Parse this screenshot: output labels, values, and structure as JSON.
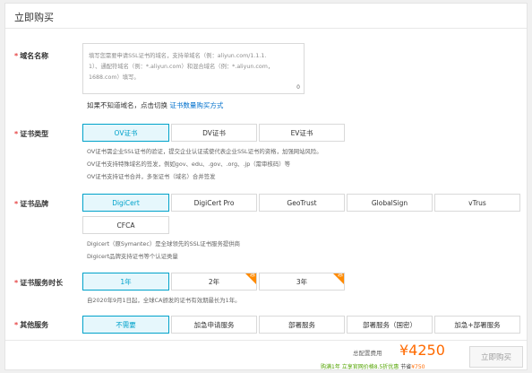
{
  "page_title": "立即购买",
  "domain": {
    "label": "域名名称",
    "required_mark": "*",
    "placeholder_lines": [
      "填写您需要申请SSL证书的域名，支持单域名（例：aliyun.com/1.1.1.",
      "1）、通配符域名（例：*.aliyun.com）和混合域名（例：*.aliyun.com，",
      "1688.com）填写。"
    ],
    "char_count": "0",
    "switch_tip": "如果不知道域名，点击切换",
    "switch_link": "证书数量购买方式"
  },
  "cert_type": {
    "label": "证书类型",
    "required_mark": "*",
    "options": [
      "OV证书",
      "DV证书",
      "EV证书"
    ],
    "selected": "OV证书",
    "hints": [
      "OV证书需企业SSL证书的验证，提交企业认证或使代表企业SSL证书的资格，加强网站风险。",
      "OV证书支持特殊域名的签发，例如gov、edu、.gov、.org、.jp（需审核码）等",
      "OV证书支持证书合并，多张证书（域名）合并签发"
    ]
  },
  "cert_brand": {
    "label": "证书品牌",
    "required_mark": "*",
    "options": [
      "DigiCert",
      "DigiCert Pro",
      "GeoTrust",
      "GlobalSign",
      "vTrus",
      "CFCA"
    ],
    "selected": "DigiCert",
    "hints": [
      "Digicert（原Symantec）是全球领先的SSL证书服务提供商",
      "Digicert品牌支持证书等个认证类量"
    ]
  },
  "service_duration": {
    "label": "证书服务时长",
    "required_mark": "*",
    "options": [
      "1年",
      "2年",
      "3年"
    ],
    "selected": "1年",
    "promo_corner_mark": "惠",
    "hint": "自2020年9月1日起，全球CA颁发的证书有效期最长为1年。"
  },
  "other_services": {
    "label": "其他服务",
    "required_mark": "*",
    "options": [
      "不需要",
      "加急申请服务",
      "部署服务",
      "部署服务（国密）",
      "加急+部署服务"
    ],
    "selected": "不需要"
  },
  "footer": {
    "total_label": "总配置费用",
    "price": "¥4250",
    "promo_text": "购满1年 立享官网价格8.5折优惠",
    "save_label": "节省",
    "save_amount": "¥750",
    "buy_button": "立即购买"
  },
  "colors": {
    "accent": "#00a2ca",
    "price": "#ff6a00",
    "required": "#e64545",
    "link": "#0070cc",
    "promo_green": "#52a300"
  }
}
